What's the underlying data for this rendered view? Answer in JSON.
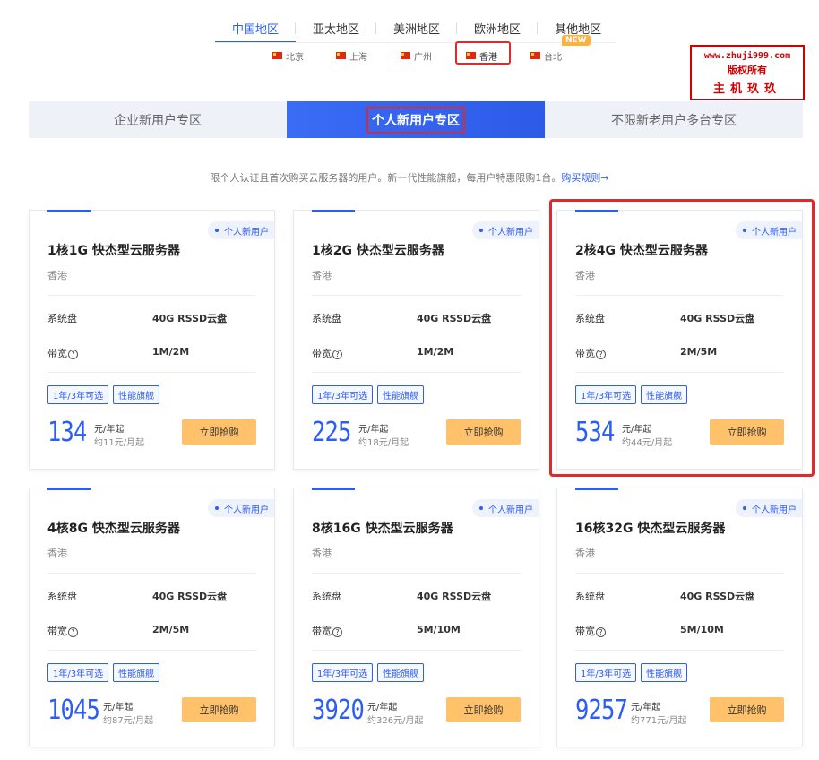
{
  "region_tabs": [
    "中国地区",
    "亚太地区",
    "美洲地区",
    "欧洲地区",
    "其他地区"
  ],
  "new_badge": "NEW",
  "cities": [
    "北京",
    "上海",
    "广州",
    "香港",
    "台北"
  ],
  "watermark": {
    "line1": "www.zhuji999.com",
    "line2": "版权所有",
    "line3": "主机玖玖"
  },
  "zone_tabs": [
    "企业新用户专区",
    "个人新用户专区",
    "不限新老用户多台专区"
  ],
  "description": "限个人认证且首次购买云服务器的用户。新一代性能旗舰，每用户特惠限购1台。",
  "rules_link": "购买规则→",
  "card_labels": {
    "tag": "个人新用户",
    "disk_label": "系统盘",
    "bw_label": "带宽",
    "q_mark": "?",
    "badge1": "1年/3年可选",
    "badge2": "性能旗舰",
    "unit": "元/年起",
    "buy": "立即抢购"
  },
  "cards": [
    {
      "title": "1核1G 快杰型云服务器",
      "location": "香港",
      "disk": "40G RSSD云盘",
      "bandwidth": "1M/2M",
      "price": "134",
      "monthly": "约11元/月起"
    },
    {
      "title": "1核2G 快杰型云服务器",
      "location": "香港",
      "disk": "40G RSSD云盘",
      "bandwidth": "1M/2M",
      "price": "225",
      "monthly": "约18元/月起"
    },
    {
      "title": "2核4G 快杰型云服务器",
      "location": "香港",
      "disk": "40G RSSD云盘",
      "bandwidth": "2M/5M",
      "price": "534",
      "monthly": "约44元/月起"
    },
    {
      "title": "4核8G 快杰型云服务器",
      "location": "香港",
      "disk": "40G RSSD云盘",
      "bandwidth": "2M/5M",
      "price": "1045",
      "monthly": "约87元/月起"
    },
    {
      "title": "8核16G 快杰型云服务器",
      "location": "香港",
      "disk": "40G RSSD云盘",
      "bandwidth": "5M/10M",
      "price": "3920",
      "monthly": "约326元/月起"
    },
    {
      "title": "16核32G 快杰型云服务器",
      "location": "香港",
      "disk": "40G RSSD云盘",
      "bandwidth": "5M/10M",
      "price": "9257",
      "monthly": "约771元/月起"
    }
  ],
  "colors": {
    "accent": "#2c5df5",
    "buy_button": "#ffc16a",
    "highlight_box": "#e02a2a"
  }
}
